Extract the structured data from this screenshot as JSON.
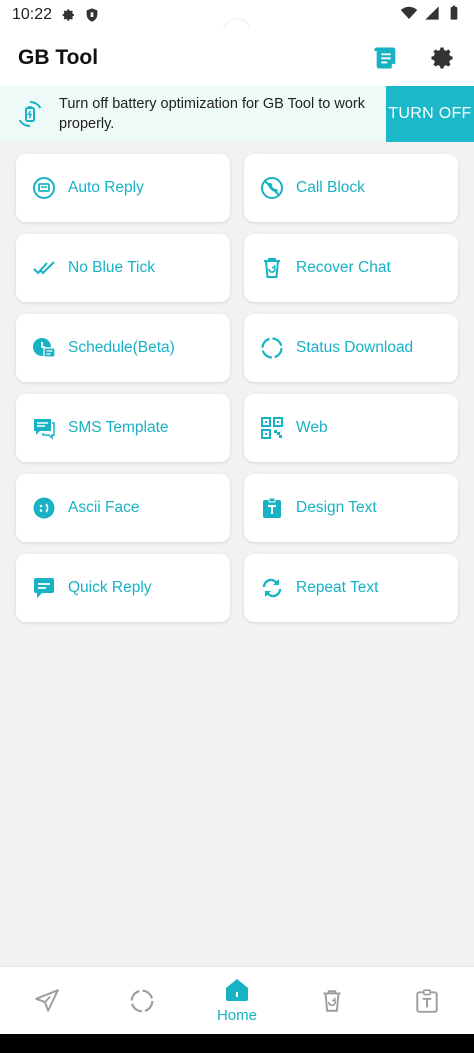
{
  "status_bar": {
    "time": "10:22"
  },
  "app_bar": {
    "title": "GB Tool"
  },
  "banner": {
    "message": "Turn off battery optimization for GB Tool to work properly.",
    "button_label": "TURN OFF"
  },
  "features": [
    {
      "label": "Auto Reply",
      "icon": "auto-reply-icon"
    },
    {
      "label": "Call Block",
      "icon": "call-block-icon"
    },
    {
      "label": "No Blue Tick",
      "icon": "double-check-icon"
    },
    {
      "label": "Recover Chat",
      "icon": "recover-bin-icon"
    },
    {
      "label": "Schedule(Beta)",
      "icon": "schedule-chat-icon"
    },
    {
      "label": "Status Download",
      "icon": "status-circle-icon"
    },
    {
      "label": "SMS Template",
      "icon": "sms-template-icon"
    },
    {
      "label": "Web",
      "icon": "qr-code-icon"
    },
    {
      "label": "Ascii Face",
      "icon": "face-icon"
    },
    {
      "label": "Design Text",
      "icon": "design-text-icon"
    },
    {
      "label": "Quick Reply",
      "icon": "quick-reply-icon"
    },
    {
      "label": "Repeat Text",
      "icon": "repeat-icon"
    }
  ],
  "bottom_nav": [
    {
      "icon": "send-icon",
      "label": ""
    },
    {
      "icon": "status-circle-icon",
      "label": ""
    },
    {
      "icon": "home-icon",
      "label": "Home",
      "active": true
    },
    {
      "icon": "recover-bin-icon",
      "label": ""
    },
    {
      "icon": "design-text-icon",
      "label": ""
    }
  ],
  "colors": {
    "accent": "#1ab8c8",
    "inactive": "#9e9e9e"
  }
}
